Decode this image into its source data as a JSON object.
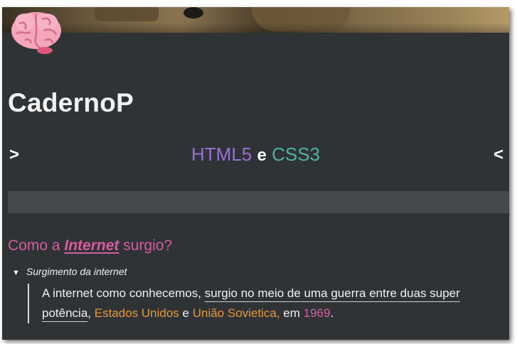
{
  "header": {
    "site_title": "CadernoP",
    "brain_icon": "brain-icon"
  },
  "nav": {
    "prev_label": ">",
    "next_label": "<",
    "tech_1": "HTML5",
    "conjunction": "e",
    "tech_2": "CSS3"
  },
  "colors": {
    "background": "#2f3336",
    "bar": "#45494d",
    "html5": "#9a6fd6",
    "css3": "#4fb2a4",
    "heading": "#d65ca0",
    "highlight_orange": "#e8963a",
    "highlight_pink": "#d65ca0"
  },
  "section": {
    "heading_pre": "Como a ",
    "heading_em": "Internet",
    "heading_post": " surgio?",
    "details_summary": "Surgimento da internet",
    "toggle_icon": "triangle-down-icon",
    "text_1": "A internet como conhecemos, ",
    "text_underlined": "surgio no meio de uma guerra entre duas super potência",
    "text_2": ", ",
    "country_1": "Estados Unidos",
    "text_3": " e ",
    "country_2": "União Sovietica,",
    "text_4": " em ",
    "year": "1969",
    "text_5": "."
  }
}
